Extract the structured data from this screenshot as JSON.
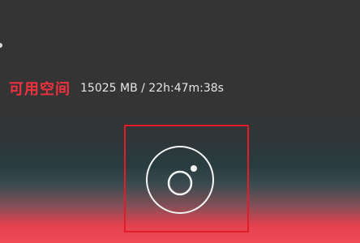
{
  "storage": {
    "label": "可用空间",
    "value": "15025 MB / 22h:47m:38s"
  },
  "camera": {
    "icon": "camera-lens-icon"
  }
}
